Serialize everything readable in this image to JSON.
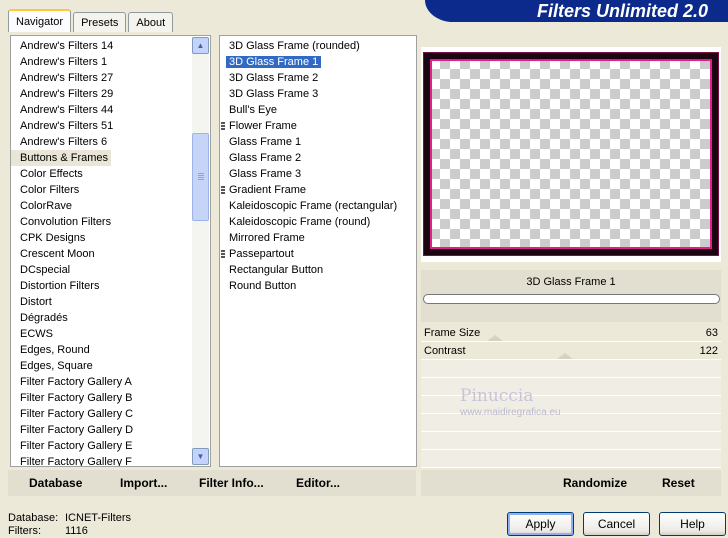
{
  "header": {
    "title": "Filters Unlimited 2.0"
  },
  "tabs": [
    {
      "label": "Navigator",
      "active": true
    },
    {
      "label": "Presets",
      "active": false
    },
    {
      "label": "About",
      "active": false
    }
  ],
  "categories": {
    "selected": "Buttons & Frames",
    "items": [
      "Andrew's Filters 14",
      "Andrew's Filters 1",
      "Andrew's Filters 27",
      "Andrew's Filters 29",
      "Andrew's Filters 44",
      "Andrew's Filters 51",
      "Andrew's Filters 6",
      "Buttons & Frames",
      "Color Effects",
      "Color Filters",
      "ColorRave",
      "Convolution Filters",
      "CPK Designs",
      "Crescent Moon",
      "DCspecial",
      "Distortion Filters",
      "Distort",
      "Dégradés",
      "ECWS",
      "Edges, Round",
      "Edges, Square",
      "Filter Factory Gallery A",
      "Filter Factory Gallery B",
      "Filter Factory Gallery C",
      "Filter Factory Gallery D",
      "Filter Factory Gallery E",
      "Filter Factory Gallery F"
    ]
  },
  "filters": {
    "selected": "3D Glass Frame 1",
    "items": [
      {
        "label": "3D Glass Frame (rounded)",
        "group": false
      },
      {
        "label": "3D Glass Frame 1",
        "group": false
      },
      {
        "label": "3D Glass Frame 2",
        "group": false
      },
      {
        "label": "3D Glass Frame 3",
        "group": false
      },
      {
        "label": "Bull's Eye",
        "group": false
      },
      {
        "label": "Flower Frame",
        "group": true
      },
      {
        "label": "Glass Frame 1",
        "group": false
      },
      {
        "label": "Glass Frame 2",
        "group": false
      },
      {
        "label": "Glass Frame 3",
        "group": false
      },
      {
        "label": "Gradient Frame",
        "group": true
      },
      {
        "label": "Kaleidoscopic Frame (rectangular)",
        "group": false
      },
      {
        "label": "Kaleidoscopic Frame (round)",
        "group": false
      },
      {
        "label": "Mirrored Frame",
        "group": false
      },
      {
        "label": "Passepartout",
        "group": true
      },
      {
        "label": "Rectangular Button",
        "group": false
      },
      {
        "label": "Round Button",
        "group": false
      }
    ]
  },
  "preview": {
    "filter_name": "3D Glass Frame 1"
  },
  "params": [
    {
      "label": "Frame Size",
      "value": "63"
    },
    {
      "label": "Contrast",
      "value": "122"
    }
  ],
  "watermark": {
    "name": "Pinuccia",
    "url": "www.maidiregrafica.eu"
  },
  "left_buttons": {
    "database": "Database",
    "import": "Import...",
    "filter_info": "Filter Info...",
    "editor": "Editor..."
  },
  "right_buttons": {
    "randomize": "Randomize",
    "reset": "Reset"
  },
  "status": {
    "database_label": "Database:",
    "database_value": "ICNET-Filters",
    "filters_label": "Filters:",
    "filters_value": "1116"
  },
  "dialog_buttons": {
    "apply": "Apply",
    "cancel": "Cancel",
    "help": "Help"
  }
}
